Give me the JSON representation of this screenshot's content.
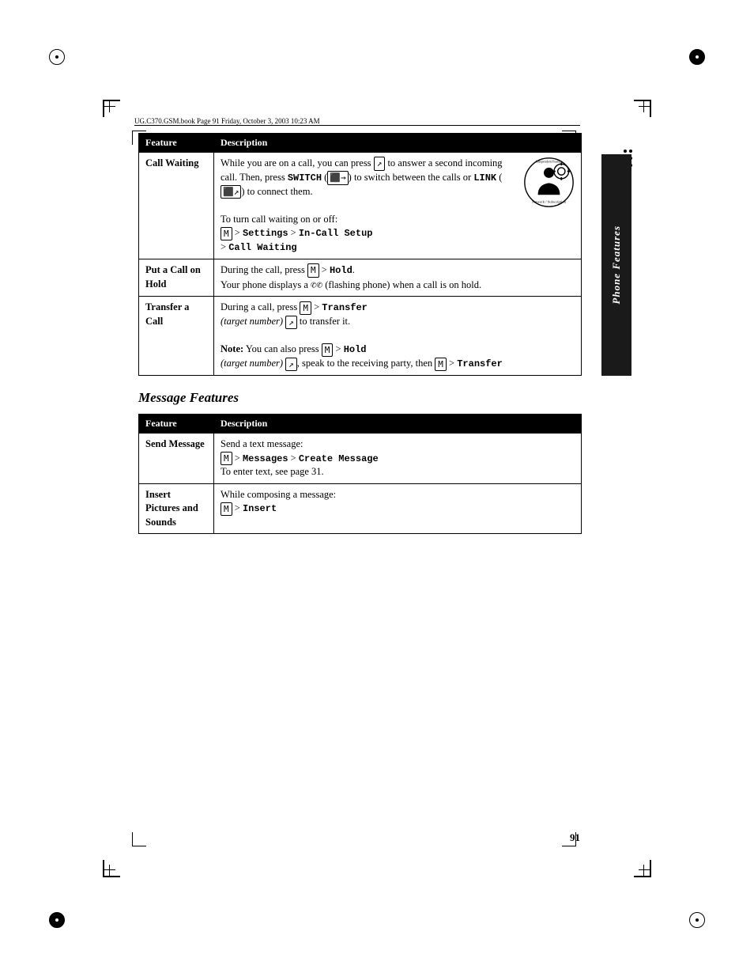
{
  "page": {
    "number": "91",
    "file_info": "UG.C370.GSM.book  Page 91  Friday, October 3, 2003  10:23 AM"
  },
  "side_tab": {
    "text": "Phone Features"
  },
  "phone_features_table": {
    "header": [
      "Feature",
      "Description"
    ],
    "rows": [
      {
        "feature": "Call Waiting",
        "description_parts": [
          "While you are on a call, you can press",
          "to answer a second incoming call. Then, press",
          "SWITCH",
          "to switch between the calls or",
          "LINK",
          "to connect them.",
          "",
          "To turn call waiting on or off:",
          "> Settings > In-Call Setup > Call Waiting"
        ]
      },
      {
        "feature": "Put a Call on Hold",
        "description_parts": [
          "During the call, press",
          "> Hold.",
          "Your phone displays a",
          "(flashing phone) when a call is on hold."
        ]
      },
      {
        "feature": "Transfer a Call",
        "description_parts": [
          "During a call, press",
          "> Transfer",
          "(target number)",
          "to transfer it.",
          "",
          "Note: You can also press",
          "> Hold",
          "(target number)",
          ", speak to the receiving party, then",
          "> Transfer"
        ]
      }
    ]
  },
  "message_features": {
    "title": "Message Features",
    "table": {
      "header": [
        "Feature",
        "Description"
      ],
      "rows": [
        {
          "feature": "Send Message",
          "description": "Send a text message:\n> Messages > Create Message\nTo enter text, see page 31."
        },
        {
          "feature": "Insert Pictures and Sounds",
          "description": "While composing a message:\n> Insert"
        }
      ]
    }
  }
}
